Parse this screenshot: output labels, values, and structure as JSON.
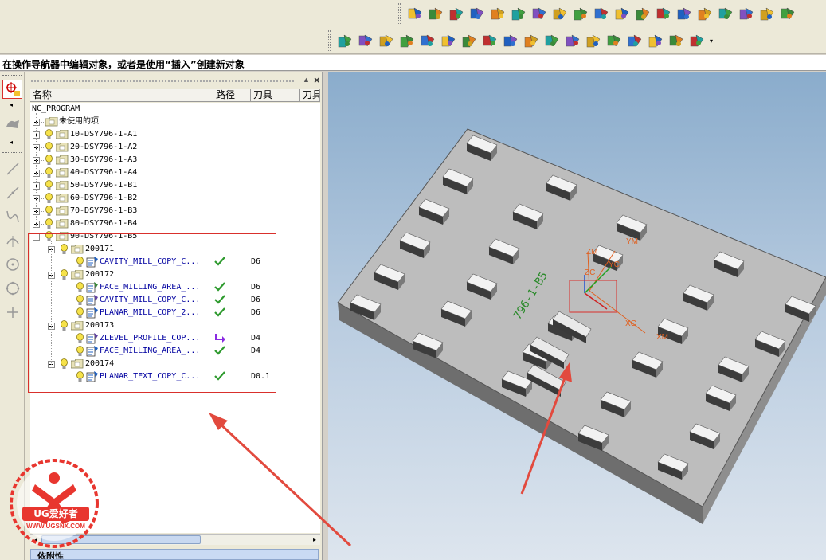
{
  "prompt": "在操作导航器中编辑对象，或者是使用“插入”创建新对象",
  "toolbar": {
    "row1_icons": [
      "tool-library-icon",
      "tool-path-icon",
      "edit-path-icon",
      "move-path-icon",
      "generate-path-icon",
      "replay-path-icon",
      "list-path-icon",
      "verify-path-icon",
      "simulate-icon",
      "post-process-icon",
      "shop-doc-icon",
      "output-cls-icon",
      "tool-wizard-icon",
      "feeds-icon",
      "machine-icon",
      "ipw-icon",
      "clamp-icon",
      "plot-icon",
      "program-order-icon"
    ],
    "row2_icons": [
      "create-program-icon",
      "create-tool-icon",
      "create-geometry-icon",
      "create-method-icon",
      "create-operation-icon",
      "color-table-icon",
      "material-icon",
      "paint-icon",
      "workpiece-icon",
      "blank-icon",
      "process-icon",
      "copy-object-icon",
      "layer-icon",
      "cut-region-icon",
      "transform-icon",
      "display-icon",
      "calculator-icon",
      "settings-icon"
    ]
  },
  "navigator": {
    "columns": [
      "名称",
      "路径",
      "刀具",
      "刀具"
    ],
    "root": "NC_PROGRAM",
    "unused": "未使用的项",
    "programs": [
      "10-DSY796-1-A1",
      "20-DSY796-1-A2",
      "30-DSY796-1-A3",
      "40-DSY796-1-A4",
      "50-DSY796-1-B1",
      "60-DSY796-1-B2",
      "70-DSY796-1-B3",
      "80-DSY796-1-B4",
      "90-DSY796-1-B5"
    ],
    "subgroups": [
      {
        "name": "200171",
        "ops": [
          {
            "name": "CAVITY_MILL_COPY_C...",
            "status": "ok",
            "tool": "D6"
          }
        ]
      },
      {
        "name": "200172",
        "ops": [
          {
            "name": "FACE_MILLING_AREA_...",
            "status": "ok",
            "tool": "D6"
          },
          {
            "name": "CAVITY_MILL_COPY_C...",
            "status": "ok",
            "tool": "D6"
          },
          {
            "name": "PLANAR_MILL_COPY_2...",
            "status": "ok",
            "tool": "D6"
          }
        ]
      },
      {
        "name": "200173",
        "ops": [
          {
            "name": "ZLEVEL_PROFILE_COP...",
            "status": "regenerate",
            "tool": "D4"
          },
          {
            "name": "FACE_MILLING_AREA_...",
            "status": "ok",
            "tool": "D4"
          }
        ]
      },
      {
        "name": "200174",
        "ops": [
          {
            "name": "PLANAR_TEXT_COPY_C...",
            "status": "ok",
            "tool": "D0.1"
          }
        ]
      }
    ],
    "bottom_label": "依附性"
  },
  "graphics": {
    "part_text": "796-1-B5",
    "axis_labels": {
      "zm": "ZM",
      "ym": "YM",
      "zc": "ZC",
      "yc": "YC",
      "xc": "XC",
      "xm": "XM"
    }
  },
  "watermark": {
    "brand": "UG爱好者",
    "url": "WWW.UGSNX.COM"
  },
  "colors": {
    "highlight": "#d9302c",
    "ok_check": "#2e9a2e",
    "regen": "#8a2be2",
    "op_text": "#0000a0"
  }
}
